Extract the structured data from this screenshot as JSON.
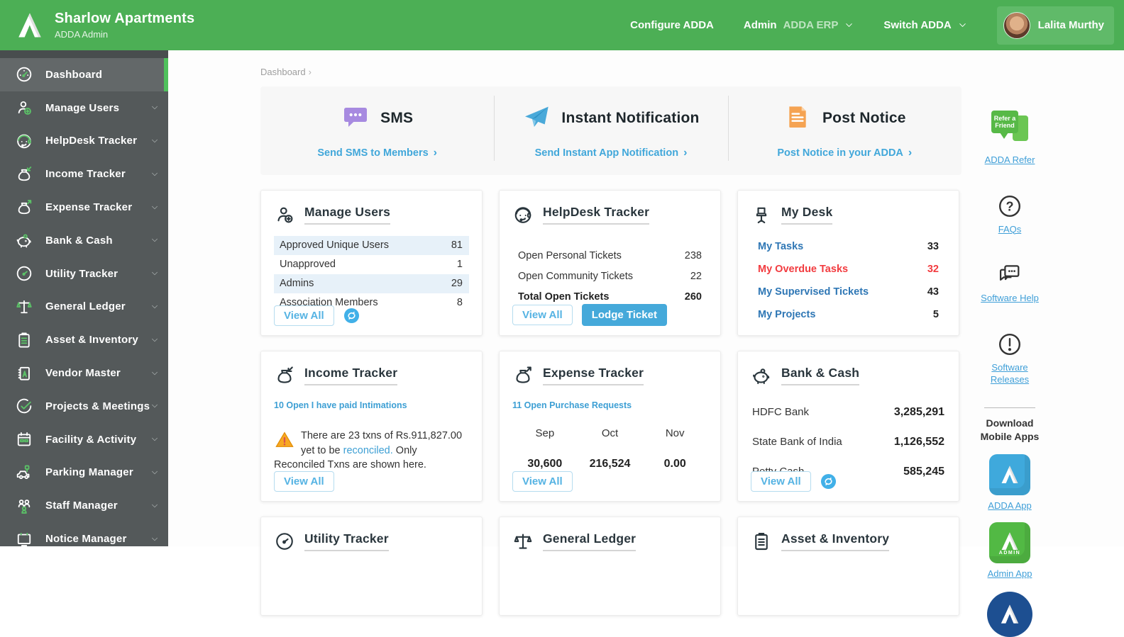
{
  "header": {
    "org_name": "Sharlow Apartments",
    "app_name": "ADDA Admin",
    "configure_label": "Configure ADDA",
    "admin_label": "Admin",
    "admin_value": "ADDA ERP",
    "switch_label": "Switch ADDA",
    "user_name": "Lalita Murthy"
  },
  "breadcrumb": {
    "current": "Dashboard",
    "sep": "›"
  },
  "sidebar": {
    "items": [
      {
        "label": "Dashboard",
        "icon": "dashboard-icon",
        "active": true,
        "has_chevron": false
      },
      {
        "label": "Manage Users",
        "icon": "manage-users-icon",
        "active": false,
        "has_chevron": true
      },
      {
        "label": "HelpDesk Tracker",
        "icon": "helpdesk-icon",
        "active": false,
        "has_chevron": true
      },
      {
        "label": "Income Tracker",
        "icon": "income-icon",
        "active": false,
        "has_chevron": true
      },
      {
        "label": "Expense Tracker",
        "icon": "expense-icon",
        "active": false,
        "has_chevron": true
      },
      {
        "label": "Bank & Cash",
        "icon": "piggy-icon",
        "active": false,
        "has_chevron": true
      },
      {
        "label": "Utility Tracker",
        "icon": "gauge-icon",
        "active": false,
        "has_chevron": true
      },
      {
        "label": "General Ledger",
        "icon": "scales-icon",
        "active": false,
        "has_chevron": true
      },
      {
        "label": "Asset & Inventory",
        "icon": "clipboard-icon",
        "active": false,
        "has_chevron": true
      },
      {
        "label": "Vendor Master",
        "icon": "vendor-icon",
        "active": false,
        "has_chevron": true
      },
      {
        "label": "Projects & Meetings",
        "icon": "check-circle-icon",
        "active": false,
        "has_chevron": true
      },
      {
        "label": "Facility & Activity",
        "icon": "calendar-icon",
        "active": false,
        "has_chevron": true
      },
      {
        "label": "Parking Manager",
        "icon": "car-icon",
        "active": false,
        "has_chevron": true
      },
      {
        "label": "Staff Manager",
        "icon": "staff-icon",
        "active": false,
        "has_chevron": true
      },
      {
        "label": "Notice Manager",
        "icon": "notice-board-icon",
        "active": false,
        "has_chevron": true
      }
    ]
  },
  "promo": {
    "sections": [
      {
        "title": "SMS",
        "link": "Send SMS to Members",
        "arrow": "›",
        "icon": "sms-bubble-icon"
      },
      {
        "title": "Instant Notification",
        "link": "Send Instant App Notification",
        "arrow": "›",
        "icon": "paper-plane-icon"
      },
      {
        "title": "Post Notice",
        "link": "Post Notice in your ADDA",
        "arrow": "›",
        "icon": "notice-doc-icon"
      }
    ]
  },
  "cards": {
    "manage_users": {
      "title": "Manage Users",
      "rows": [
        {
          "label": "Approved Unique Users",
          "value": "81"
        },
        {
          "label": "Unapproved",
          "value": "1"
        },
        {
          "label": "Admins",
          "value": "29"
        },
        {
          "label": "Association Members",
          "value": "8"
        }
      ],
      "view_all": "View All"
    },
    "helpdesk": {
      "title": "HelpDesk Tracker",
      "rows": [
        {
          "label": "Open Personal Tickets",
          "value": "238"
        },
        {
          "label": "Open Community Tickets",
          "value": "22"
        },
        {
          "label": "Total Open Tickets",
          "value": "260"
        }
      ],
      "view_all": "View All",
      "lodge": "Lodge Ticket"
    },
    "my_desk": {
      "title": "My Desk",
      "rows": [
        {
          "label": "My Tasks",
          "value": "33"
        },
        {
          "label": "My Overdue Tasks",
          "value": "32"
        },
        {
          "label": "My Supervised Tickets",
          "value": "43"
        },
        {
          "label": "My Projects",
          "value": "5"
        }
      ]
    },
    "income": {
      "title": "Income Tracker",
      "open_link": "10 Open I have paid Intimations",
      "warn_pre": "There are 23 txns of Rs.911,827.00 yet to be ",
      "warn_link": "reconciled.",
      "warn_post": " Only Reconciled Txns are shown here.",
      "view_all": "View All"
    },
    "expense": {
      "title": "Expense Tracker",
      "open_link": "11 Open Purchase Requests",
      "months": [
        "Sep",
        "Oct",
        "Nov"
      ],
      "values": [
        "30,600",
        "216,524",
        "0.00"
      ],
      "view_all": "View All"
    },
    "bank": {
      "title": "Bank & Cash",
      "rows": [
        {
          "label": "HDFC Bank",
          "value": "3,285,291"
        },
        {
          "label": "State Bank of India",
          "value": "1,126,552"
        },
        {
          "label": "Petty Cash",
          "value": "585,245"
        }
      ],
      "view_all": "View All"
    },
    "utility": {
      "title": "Utility Tracker"
    },
    "ledger": {
      "title": "General Ledger"
    },
    "asset": {
      "title": "Asset & Inventory"
    }
  },
  "rail": {
    "refer_badge_line1": "Refer a",
    "refer_badge_line2": "Friend",
    "refer_link": "ADDA Refer",
    "faqs_link": "FAQs",
    "help_link": "Software Help",
    "releases_link": "Software Releases",
    "download_head": "Download Mobile Apps",
    "adda_app_link": "ADDA App",
    "admin_app_link": "Admin App",
    "admin_tile_text": "ADMIN"
  },
  "colors": {
    "header_green": "#4caf55",
    "sidebar_gray": "#54595a",
    "active_green_bar": "#4fc15c",
    "link_blue": "#41a7da",
    "desk_blue": "#2f77b5",
    "overdue_red": "#f23b3f",
    "row_highlight": "#e7f1f9",
    "sms_purple": "#a78ae0",
    "plane_blue": "#4aa9d9",
    "notice_orange": "#f5a352",
    "button_blue": "#45a9da"
  }
}
